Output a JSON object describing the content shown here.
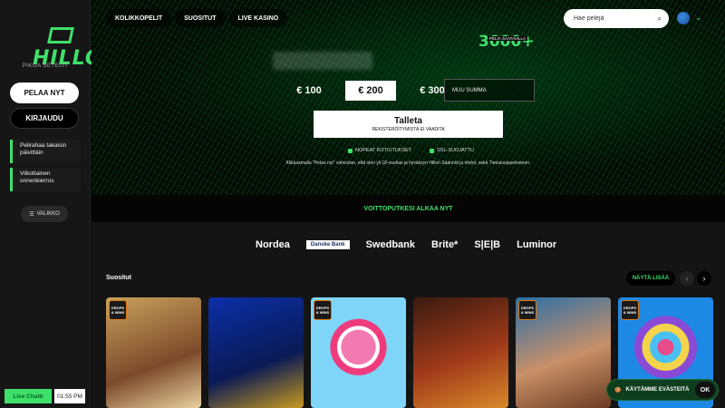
{
  "brand": {
    "logo_text": "HILLO",
    "tagline": "PIKOA SETELIT"
  },
  "sidebar": {
    "play_now": "PELAA NYT",
    "login": "KIRJAUDU",
    "promos": [
      "Pelirahaa takaisin päivittäin",
      "Viikottainen onnenkierros"
    ],
    "menu": "VALIKKO",
    "live_chat": "Live Chatti",
    "clock": "01:55 PM"
  },
  "topnav": [
    "KOLIKKOPELIT",
    "SUOSITUT",
    "LIVE KASINO"
  ],
  "search": {
    "placeholder": "Hae pelejä"
  },
  "hero": {
    "games_count": "3000+",
    "games_label": "PELIÄ SAATAVILLA",
    "amounts": [
      "€ 100",
      "€ 200",
      "€ 300"
    ],
    "selected_amount": "€ 200",
    "other_amount_placeholder": "MUU SUMMA",
    "deposit_label": "Talleta",
    "deposit_sub": "REKISTERÖITYMISTÄ EI VAADITA",
    "feature_1": "NOPEAT KOTIUTUKSET",
    "feature_2": "SSL-SUOJATTU",
    "terms_text": "Klikkaamalla \"Pelaa nyt\" vahvistan, että olen yli 18-vuotias ja hyväksyn Hillon Säännöt ja ehdot, sekä Tietosuojaselosteen."
  },
  "strip_text": "VOITTOPUTKESI ALKAA NYT",
  "banks": [
    "Nordea",
    "Danske Bank",
    "Swedbank",
    "Brite*",
    "S|E|B",
    "Luminor"
  ],
  "games_section": {
    "title": "Suositut",
    "show_more": "NÄYTÄ LISÄÄ",
    "drops_wins_badge": "DROPS & WINS",
    "tiles": [
      "game-1",
      "game-2",
      "game-3",
      "game-4",
      "game-5",
      "game-6"
    ]
  },
  "cookie": {
    "text": "KÄYTÄMME EVÄSTEITÄ",
    "ok": "OK"
  },
  "colors": {
    "accent": "#3fe06a",
    "background": "#0b0b0b",
    "sidebar": "#161616"
  }
}
